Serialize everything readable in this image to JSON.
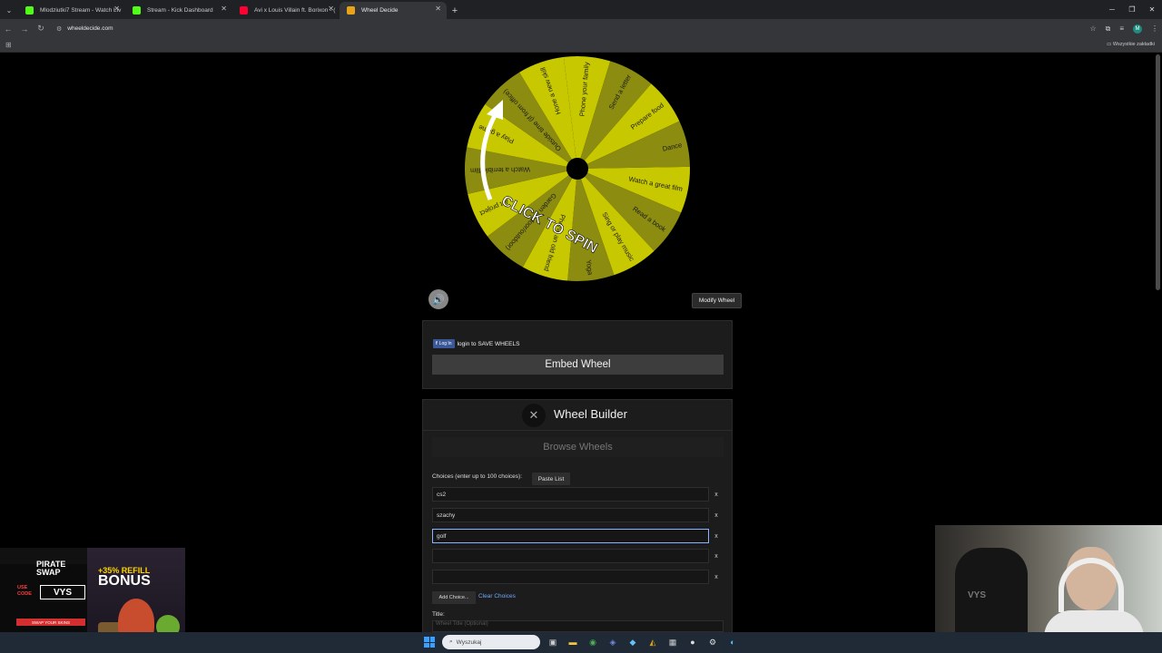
{
  "browser": {
    "tabs": [
      {
        "title": "Mlodziutki7 Stream - Watch Liv",
        "favicon_color": "#53fc18",
        "active": false
      },
      {
        "title": "Stream - Kick Dashboard",
        "favicon_color": "#53fc18",
        "active": false
      },
      {
        "title": "Avi x Louis Villain ft. Borixon - (",
        "favicon_color": "#ff0033",
        "active": false
      },
      {
        "title": "Wheel Decide",
        "favicon_color": "#e8a317",
        "active": true
      }
    ],
    "url": "wheeldecide.com",
    "bookmarks_all_label": "Wszystkie zakładki",
    "profile_initial": "M"
  },
  "wheel": {
    "segment_labels": [
      "Phone your family",
      "Send a letter",
      "Prepare food",
      "Dance",
      "Watch a great film",
      "Read a book",
      "Sing or play music",
      "Yoga",
      "Phone an old friend",
      "Garden (indoor/outdoor)",
      "Art project",
      "Watch a terrible film",
      "Play a game",
      "Outside time (if from office)",
      "Hone a new skill"
    ],
    "segment_colors": [
      "#c8c800",
      "#8c8c10"
    ],
    "spin_label": "CLICK TO SPIN"
  },
  "controls": {
    "modify_label": "Modify Wheel",
    "sound_icon": "speaker-icon"
  },
  "login": {
    "fb_button": "Log In",
    "text": "login to SAVE WHEELS",
    "embed_label": "Embed Wheel"
  },
  "builder": {
    "title": "Wheel Builder",
    "browse_label": "Browse Wheels",
    "choices_label": "Choices (enter up to 100 choices):",
    "paste_label": "Paste List",
    "choices": [
      "cs2",
      "szachy",
      "golf",
      "",
      ""
    ],
    "remove_label": "x",
    "add_label": "Add Choice...",
    "clear_label": "Clear Choices",
    "title_label": "Title:",
    "title_placeholder": "Wheel Title (Optional)"
  },
  "ad": {
    "brand_line1": "PIRATE",
    "brand_line2": "SWAP",
    "use_code": "USE\nCODE",
    "code": "VYS",
    "swap_text": "SWAP YOUR SKINS",
    "refill": "+35% REFILL",
    "bonus": "BONUS"
  },
  "webcam": {
    "hoodie_text": "VYS"
  },
  "taskbar": {
    "search_placeholder": "Wyszukaj"
  }
}
